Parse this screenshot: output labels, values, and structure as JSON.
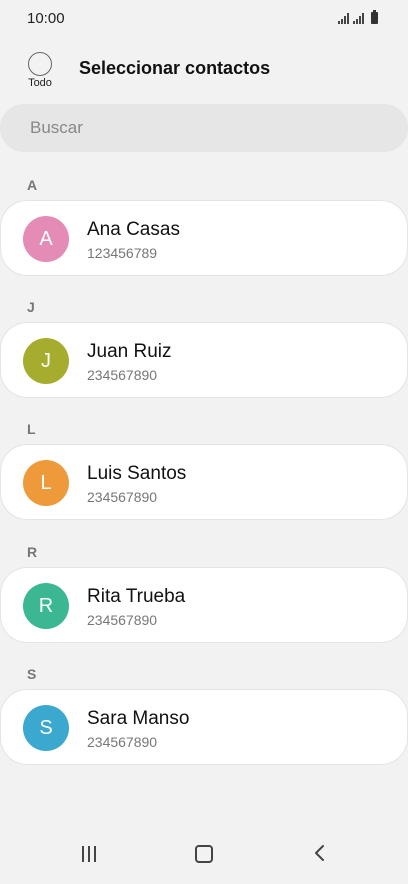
{
  "status_bar": {
    "time": "10:00"
  },
  "header": {
    "select_all_label": "Todo",
    "title": "Seleccionar contactos"
  },
  "search": {
    "placeholder": "Buscar"
  },
  "sections": [
    {
      "letter": "A",
      "contact": {
        "initial": "A",
        "name": "Ana Casas",
        "phone": "123456789",
        "color": "#e48bb6"
      }
    },
    {
      "letter": "J",
      "contact": {
        "initial": "J",
        "name": "Juan Ruiz",
        "phone": "234567890",
        "color": "#a6ad2e"
      }
    },
    {
      "letter": "L",
      "contact": {
        "initial": "L",
        "name": "Luis Santos",
        "phone": "234567890",
        "color": "#ee9a3b"
      }
    },
    {
      "letter": "R",
      "contact": {
        "initial": "R",
        "name": "Rita Trueba",
        "phone": "234567890",
        "color": "#3bb893"
      }
    },
    {
      "letter": "S",
      "contact": {
        "initial": "S",
        "name": "Sara Manso",
        "phone": "234567890",
        "color": "#3aa8cf"
      }
    }
  ],
  "nav": {
    "recent": "recent-apps-icon",
    "home": "home-icon",
    "back": "back-icon"
  }
}
